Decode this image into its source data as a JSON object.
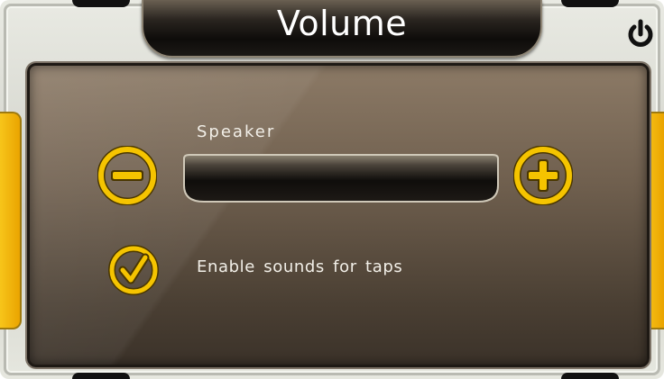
{
  "window": {
    "title": "Volume",
    "power_icon": "power-icon"
  },
  "speaker": {
    "label": "Speaker",
    "level": 0,
    "decrease_icon": "minus-icon",
    "increase_icon": "plus-icon"
  },
  "tap_sounds": {
    "label": "Enable sounds for taps",
    "checked": true,
    "icon": "checkmark-icon"
  },
  "colors": {
    "accent": "#f5c400",
    "accent_outline": "#5a4300",
    "panel": "#6f5f4e",
    "text": "#f2efe8"
  }
}
